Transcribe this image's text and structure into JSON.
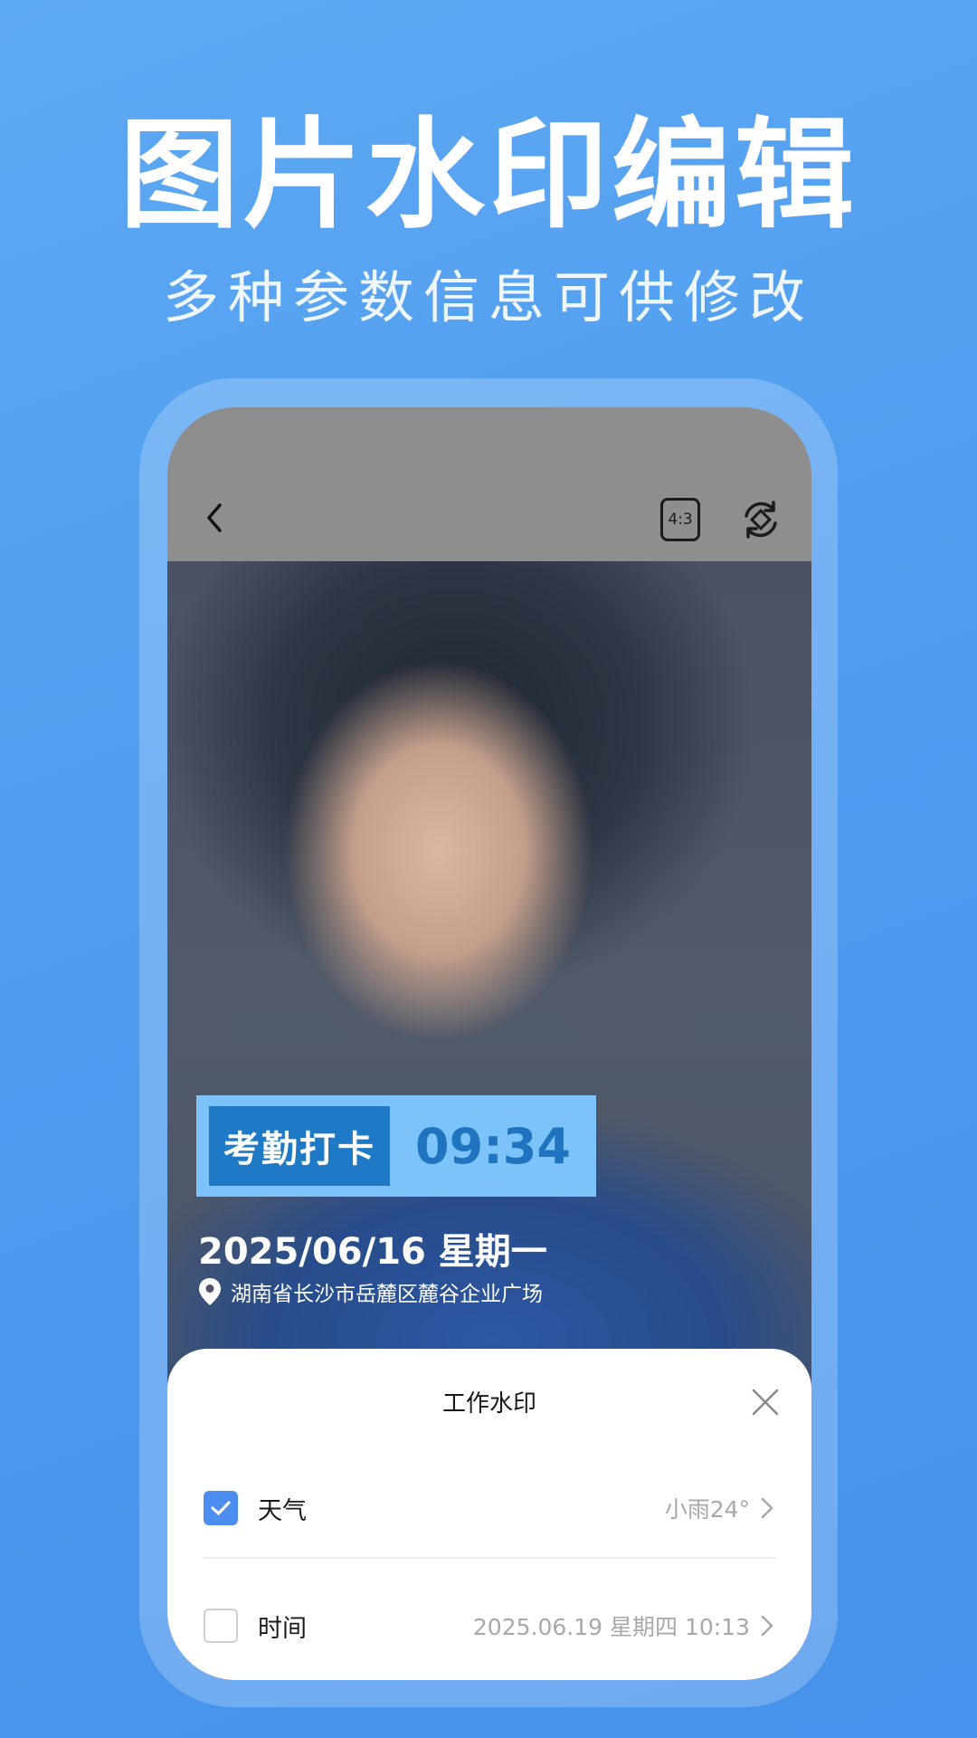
{
  "promo": {
    "headline": "图片水印编辑",
    "subheadline": "多种参数信息可供修改"
  },
  "toolbar": {
    "ratio_label": "4:3"
  },
  "watermark": {
    "badge_label": "考勤打卡",
    "time": "09:34",
    "date_line": "2025/06/16  星期一",
    "location": "湖南省长沙市岳麓区麓谷企业广场"
  },
  "sheet": {
    "title": "工作水印",
    "rows": [
      {
        "label": "天气",
        "value": "小雨24°",
        "checked": true
      },
      {
        "label": "时间",
        "value": "2025.06.19 星期四 10:13",
        "checked": false
      }
    ]
  },
  "colors": {
    "background": "#4f9cf0",
    "badge_bg": "#7cc3fb",
    "badge_label_bg": "#1e7ac6",
    "badge_time": "#1e74bf",
    "checkbox_on": "#4c8df0"
  },
  "icons": [
    "back-arrow-icon",
    "aspect-ratio-icon",
    "rotate-camera-icon",
    "location-pin-icon",
    "close-icon",
    "check-icon",
    "chevron-right-icon"
  ]
}
